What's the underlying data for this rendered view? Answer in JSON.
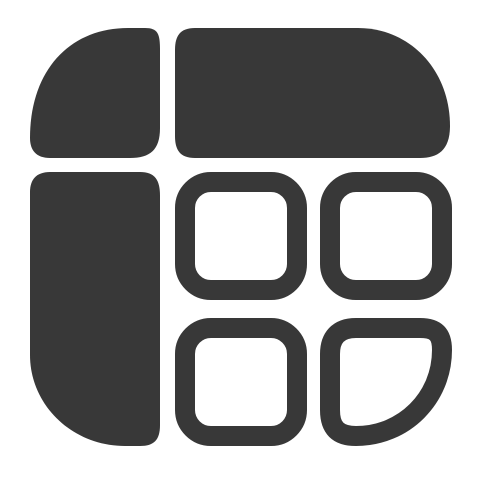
{
  "icon": {
    "name": "table-grid-icon",
    "colors": {
      "fill": "#383838",
      "stroke": "#383838",
      "background": "#ffffff"
    }
  }
}
